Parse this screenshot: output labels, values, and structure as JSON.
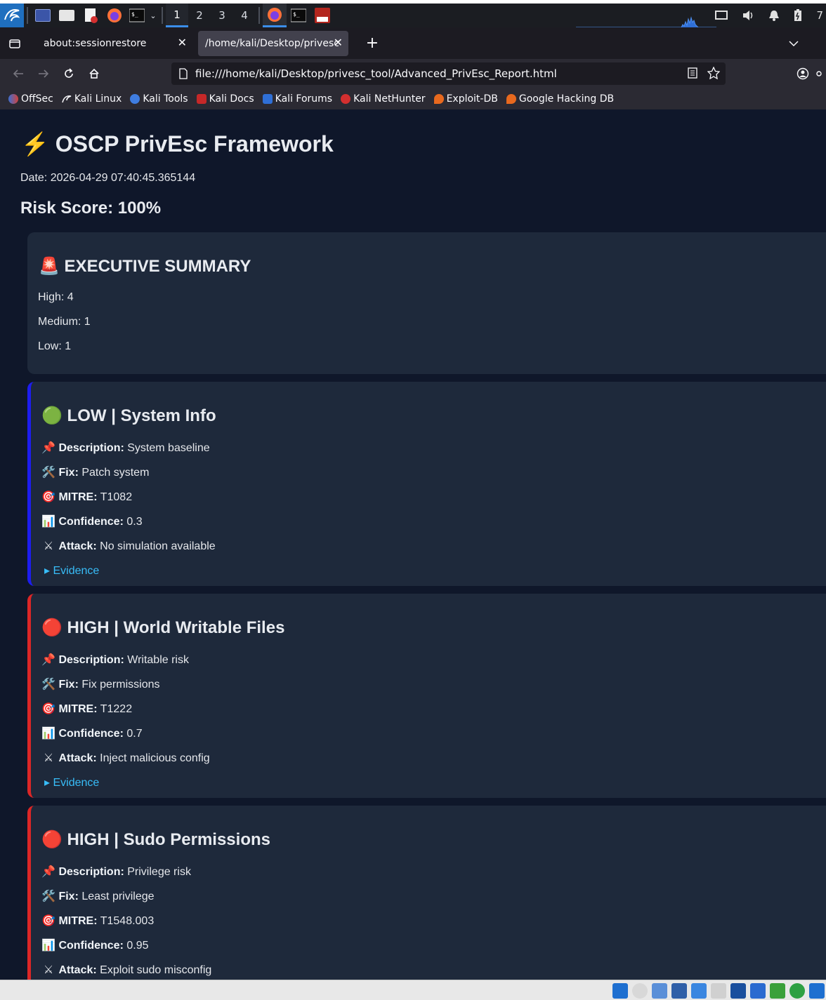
{
  "panel": {
    "workspaces": [
      "1",
      "2",
      "3",
      "4"
    ],
    "active_workspace": "1",
    "clock_partial": "7"
  },
  "browser": {
    "tabs": [
      {
        "label": "about:sessionrestore",
        "active": false
      },
      {
        "label": "/home/kali/Desktop/privesc_t",
        "active": true
      }
    ],
    "url": "file:///home/kali/Desktop/privesc_tool/Advanced_PrivEsc_Report.html",
    "bookmarks": [
      "OffSec",
      "Kali Linux",
      "Kali Tools",
      "Kali Docs",
      "Kali Forums",
      "Kali NetHunter",
      "Exploit-DB",
      "Google Hacking DB"
    ]
  },
  "report": {
    "title": "⚡ OSCP PrivEsc Framework",
    "date": "Date: 2026-04-29 07:40:45.365144",
    "risk_score": "Risk Score: 100%",
    "summary": {
      "heading": "🚨 EXECUTIVE SUMMARY",
      "high": "High: 4",
      "medium": "Medium: 1",
      "low": "Low: 1"
    },
    "labels": {
      "description": "Description:",
      "fix": "Fix:",
      "mitre": "MITRE:",
      "confidence": "Confidence:",
      "attack": "Attack:",
      "evidence": "▸ Evidence"
    },
    "findings": [
      {
        "heading": "🟢 LOW | System Info",
        "color": "#1d1df0",
        "description": "System baseline",
        "fix": "Patch system",
        "mitre": "T1082",
        "confidence": "0.3",
        "attack": "No simulation available"
      },
      {
        "heading": "🔴 HIGH | World Writable Files",
        "color": "#dc2626",
        "description": "Writable risk",
        "fix": "Fix permissions",
        "mitre": "T1222",
        "confidence": "0.7",
        "attack": "Inject malicious config"
      },
      {
        "heading": "🔴 HIGH | Sudo Permissions",
        "color": "#dc2626",
        "description": "Privilege risk",
        "fix": "Least privilege",
        "mitre": "T1548.003",
        "confidence": "0.95",
        "attack": "Exploit sudo misconfig"
      }
    ]
  }
}
